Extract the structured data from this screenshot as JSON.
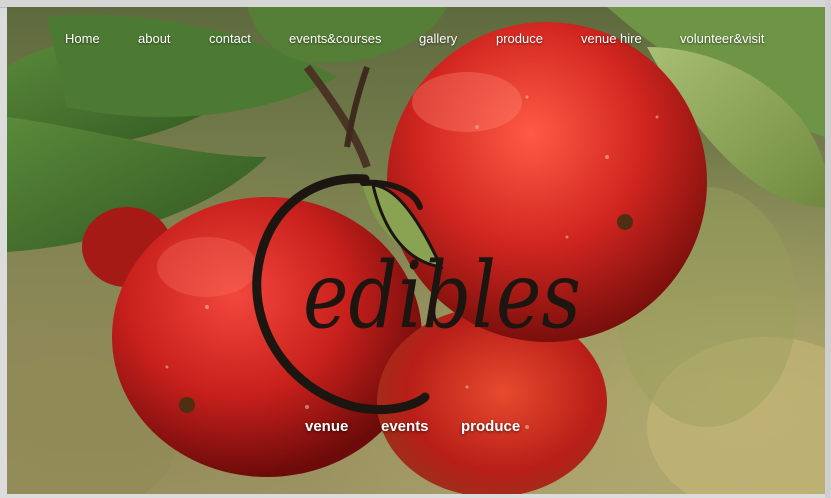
{
  "nav": {
    "items": [
      {
        "label": "Home"
      },
      {
        "label": "about"
      },
      {
        "label": "contact"
      },
      {
        "label": "events&courses"
      },
      {
        "label": "gallery"
      },
      {
        "label": "produce"
      },
      {
        "label": "venue hire"
      },
      {
        "label": "volunteer&visit"
      }
    ]
  },
  "hero": {
    "logo_text": "edibles",
    "image_subject": "red-apples-on-branch-icon"
  },
  "subnav": {
    "items": [
      {
        "label": "venue"
      },
      {
        "label": "events"
      },
      {
        "label": "produce"
      }
    ]
  },
  "colors": {
    "apple_red": "#c8201c",
    "leaf_green": "#3f6a2a",
    "logo_ink": "#1d1510",
    "nav_text": "#ffffff"
  }
}
